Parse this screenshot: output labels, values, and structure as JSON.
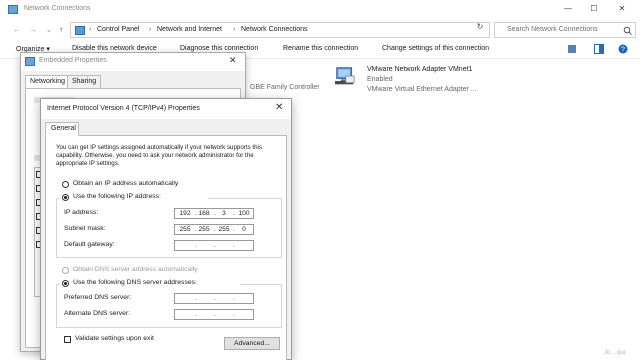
{
  "window": {
    "title": "Network Connections",
    "controls": {
      "minimize": "—",
      "maximize": "☐",
      "close": "✕"
    }
  },
  "address_bar": {
    "back": "←",
    "forward": "→",
    "recent": "⌄",
    "up": "↑",
    "breadcrumbs": [
      "Control Panel",
      "Network and Internet",
      "Network Connections"
    ],
    "separator": "›",
    "dropdown": "⌄",
    "refresh": "↻",
    "search_placeholder": "Search Network Connections"
  },
  "toolbar": {
    "organize": "Organize ▾",
    "disable": "Disable this network device",
    "diagnose": "Diagnose this connection",
    "rename": "Rename this connection",
    "change_settings": "Change settings of this connection"
  },
  "adapters": [
    {
      "name": "",
      "sub": "GBE Family Controller",
      "status": ""
    },
    {
      "name": "VMware Network Adapter VMnet1",
      "status": "Enabled",
      "sub": "VMware Virtual Ethernet Adapter ..."
    }
  ],
  "embedded_dialog": {
    "title": "Embedded Properties",
    "tabs": [
      "Networking",
      "Sharing"
    ],
    "close": "✕"
  },
  "ipv4_dialog": {
    "title": "Internet Protocol Version 4 (TCP/IPv4) Properties",
    "close": "✕",
    "tab": "General",
    "description": "You can get IP settings assigned automatically if your network supports this capability. Otherwise, you need to ask your network administrator for the appropriate IP settings.",
    "obtain_ip_auto": "Obtain an IP address automatically",
    "use_following_ip": "Use the following IP address:",
    "ip_address_label": "IP address:",
    "ip_address": [
      "192",
      "168",
      "3",
      "100"
    ],
    "subnet_label": "Subnet mask:",
    "subnet": [
      "255",
      "255",
      "255",
      "0"
    ],
    "gateway_label": "Default gateway:",
    "gateway": [
      "",
      "",
      "",
      ""
    ],
    "obtain_dns_auto": "Obtain DNS server address automatically",
    "use_following_dns": "Use the following DNS server addresses:",
    "preferred_dns_label": "Preferred DNS server:",
    "preferred_dns": [
      "",
      "",
      "",
      ""
    ],
    "alternate_dns_label": "Alternate DNS server:",
    "alternate_dns": [
      "",
      "",
      "",
      ""
    ],
    "validate_label": "Validate settings upon exit",
    "advanced_button": "Advanced..."
  },
  "watermark": "Jo... qui"
}
